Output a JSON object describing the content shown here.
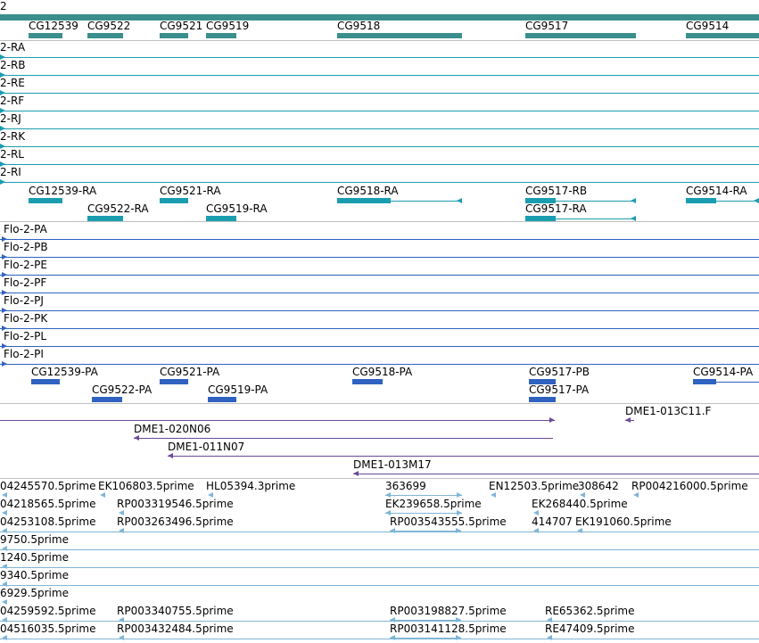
{
  "colors": {
    "gene": "#3a8f8c",
    "transcript": "#1b9db0",
    "protein": "#2f62c0",
    "clone": "#6a4a9a",
    "est": "#7fb5d6",
    "separator": "#c0c0c0",
    "text": "#000000"
  },
  "tracks": {
    "region_label": "2",
    "genes": [
      "CG12539",
      "CG9522",
      "CG9521",
      "CG9519",
      "CG9518",
      "CG9517",
      "CG9514"
    ],
    "gene_transcripts": [
      "2-RA",
      "2-RB",
      "2-RE",
      "2-RF",
      "2-RJ",
      "2-RK",
      "2-RL",
      "2-RI"
    ],
    "transcripts": [
      "CG12539-RA",
      "CG9521-RA",
      "CG9518-RA",
      "CG9517-RB",
      "CG9514-RA",
      "CG9522-RA",
      "CG9519-RA",
      "CG9517-RA"
    ],
    "gene_proteins": [
      "Flo-2-PA",
      "Flo-2-PB",
      "Flo-2-PE",
      "Flo-2-PF",
      "Flo-2-PJ",
      "Flo-2-PK",
      "Flo-2-PL",
      "Flo-2-PI"
    ],
    "proteins": [
      "CG12539-PA",
      "CG9521-PA",
      "CG9518-PA",
      "CG9517-PB",
      "CG9514-PA",
      "CG9522-PA",
      "CG9519-PA",
      "CG9517-PA"
    ],
    "clones": [
      "DME1-013C11.F",
      "DME1-020N06",
      "DME1-011N07",
      "DME1-013M17"
    ],
    "ests": [
      "04245570.5prime",
      "EK106803.5prime",
      "HL05394.3prime",
      "363699",
      "EN12503.5prime",
      "308642",
      "RP004216000.5prime",
      "04218565.5prime",
      "RP003319546.5prime",
      "EK239658.5prime",
      "EK268440.5prime",
      "04253108.5prime",
      "RP003263496.5prime",
      "RP003543555.5prime",
      "414707",
      "EK191060.5prime",
      "9750.5prime",
      "1240.5prime",
      "9340.5prime",
      "6929.5prime",
      "04259592.5prime",
      "RP003340755.5prime",
      "RP003198827.5prime",
      "RE65362.5prime",
      "04516035.5prime",
      "RP003432484.5prime",
      "RP003141128.5prime",
      "RE47409.5prime"
    ]
  }
}
